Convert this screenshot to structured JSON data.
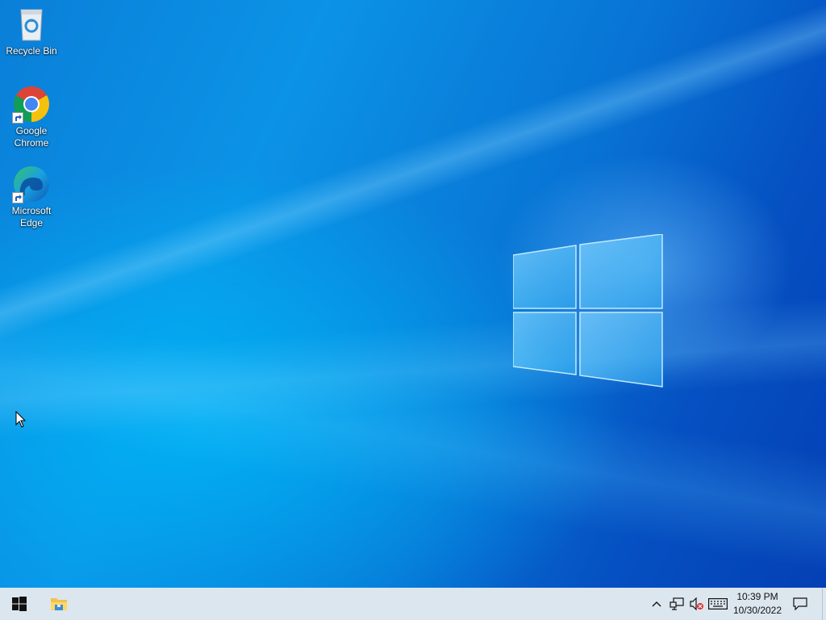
{
  "desktop": {
    "icons": [
      {
        "label": "Recycle Bin",
        "icon": "recycle-bin-icon"
      },
      {
        "label": "Google\nChrome",
        "icon": "chrome-icon"
      },
      {
        "label": "Microsoft\nEdge",
        "icon": "edge-icon"
      }
    ],
    "wallpaper": {
      "accent": "#0a7fd8",
      "logo": "windows-logo"
    }
  },
  "taskbar": {
    "start_icon": "windows-start-icon",
    "pinned": [
      {
        "icon": "file-explorer-icon"
      }
    ],
    "tray": {
      "chevron": "chevron-up-icon",
      "network": "network-icon",
      "volume": "volume-muted-icon",
      "keyboard": "touch-keyboard-icon",
      "time": "10:39 PM",
      "date": "10/30/2022",
      "notifications": "action-center-icon"
    },
    "background": "#dce6ef"
  }
}
